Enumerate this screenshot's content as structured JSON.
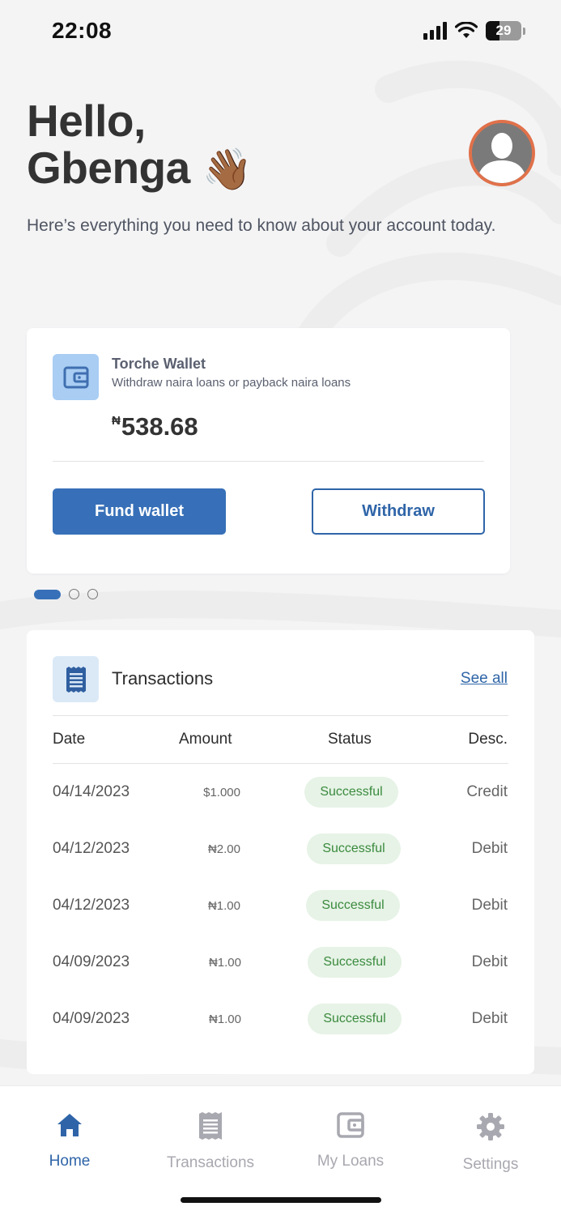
{
  "status_bar": {
    "time": "22:08",
    "battery": "29"
  },
  "header": {
    "greeting_line1": "Hello,",
    "greeting_name": "Gbenga",
    "greeting_emoji": "👋🏾",
    "subtitle": "Here’s everything you need to know about your account today."
  },
  "wallet": {
    "title": "Torche Wallet",
    "description": "Withdraw naira loans or payback naira loans",
    "currency": "₦",
    "balance": "538.68",
    "fund_label": "Fund wallet",
    "withdraw_label": "Withdraw",
    "pager": {
      "pages": 3,
      "active_index": 0
    }
  },
  "transactions": {
    "title": "Transactions",
    "see_all": "See all",
    "columns": [
      "Date",
      "Amount",
      "Status",
      "Desc."
    ],
    "rows": [
      {
        "date": "04/14/2023",
        "amount": "$1.000",
        "status": "Successful",
        "desc": "Credit"
      },
      {
        "date": "04/12/2023",
        "amount": "₦2.00",
        "status": "Successful",
        "desc": "Debit"
      },
      {
        "date": "04/12/2023",
        "amount": "₦1.00",
        "status": "Successful",
        "desc": "Debit"
      },
      {
        "date": "04/09/2023",
        "amount": "₦1.00",
        "status": "Successful",
        "desc": "Debit"
      },
      {
        "date": "04/09/2023",
        "amount": "₦1.00",
        "status": "Successful",
        "desc": "Debit"
      }
    ]
  },
  "nav": [
    {
      "label": "Home",
      "icon": "home-icon",
      "active": true
    },
    {
      "label": "Transactions",
      "icon": "receipt-icon",
      "active": false
    },
    {
      "label": "My Loans",
      "icon": "wallet-icon",
      "active": false
    },
    {
      "label": "Settings",
      "icon": "gear-icon",
      "active": false
    }
  ],
  "colors": {
    "primary": "#3770b8",
    "avatar_ring": "#e0714a",
    "success_bg": "#e6f3e6",
    "success_text": "#3b8a3e",
    "nav_inactive": "#a8a8b0"
  }
}
